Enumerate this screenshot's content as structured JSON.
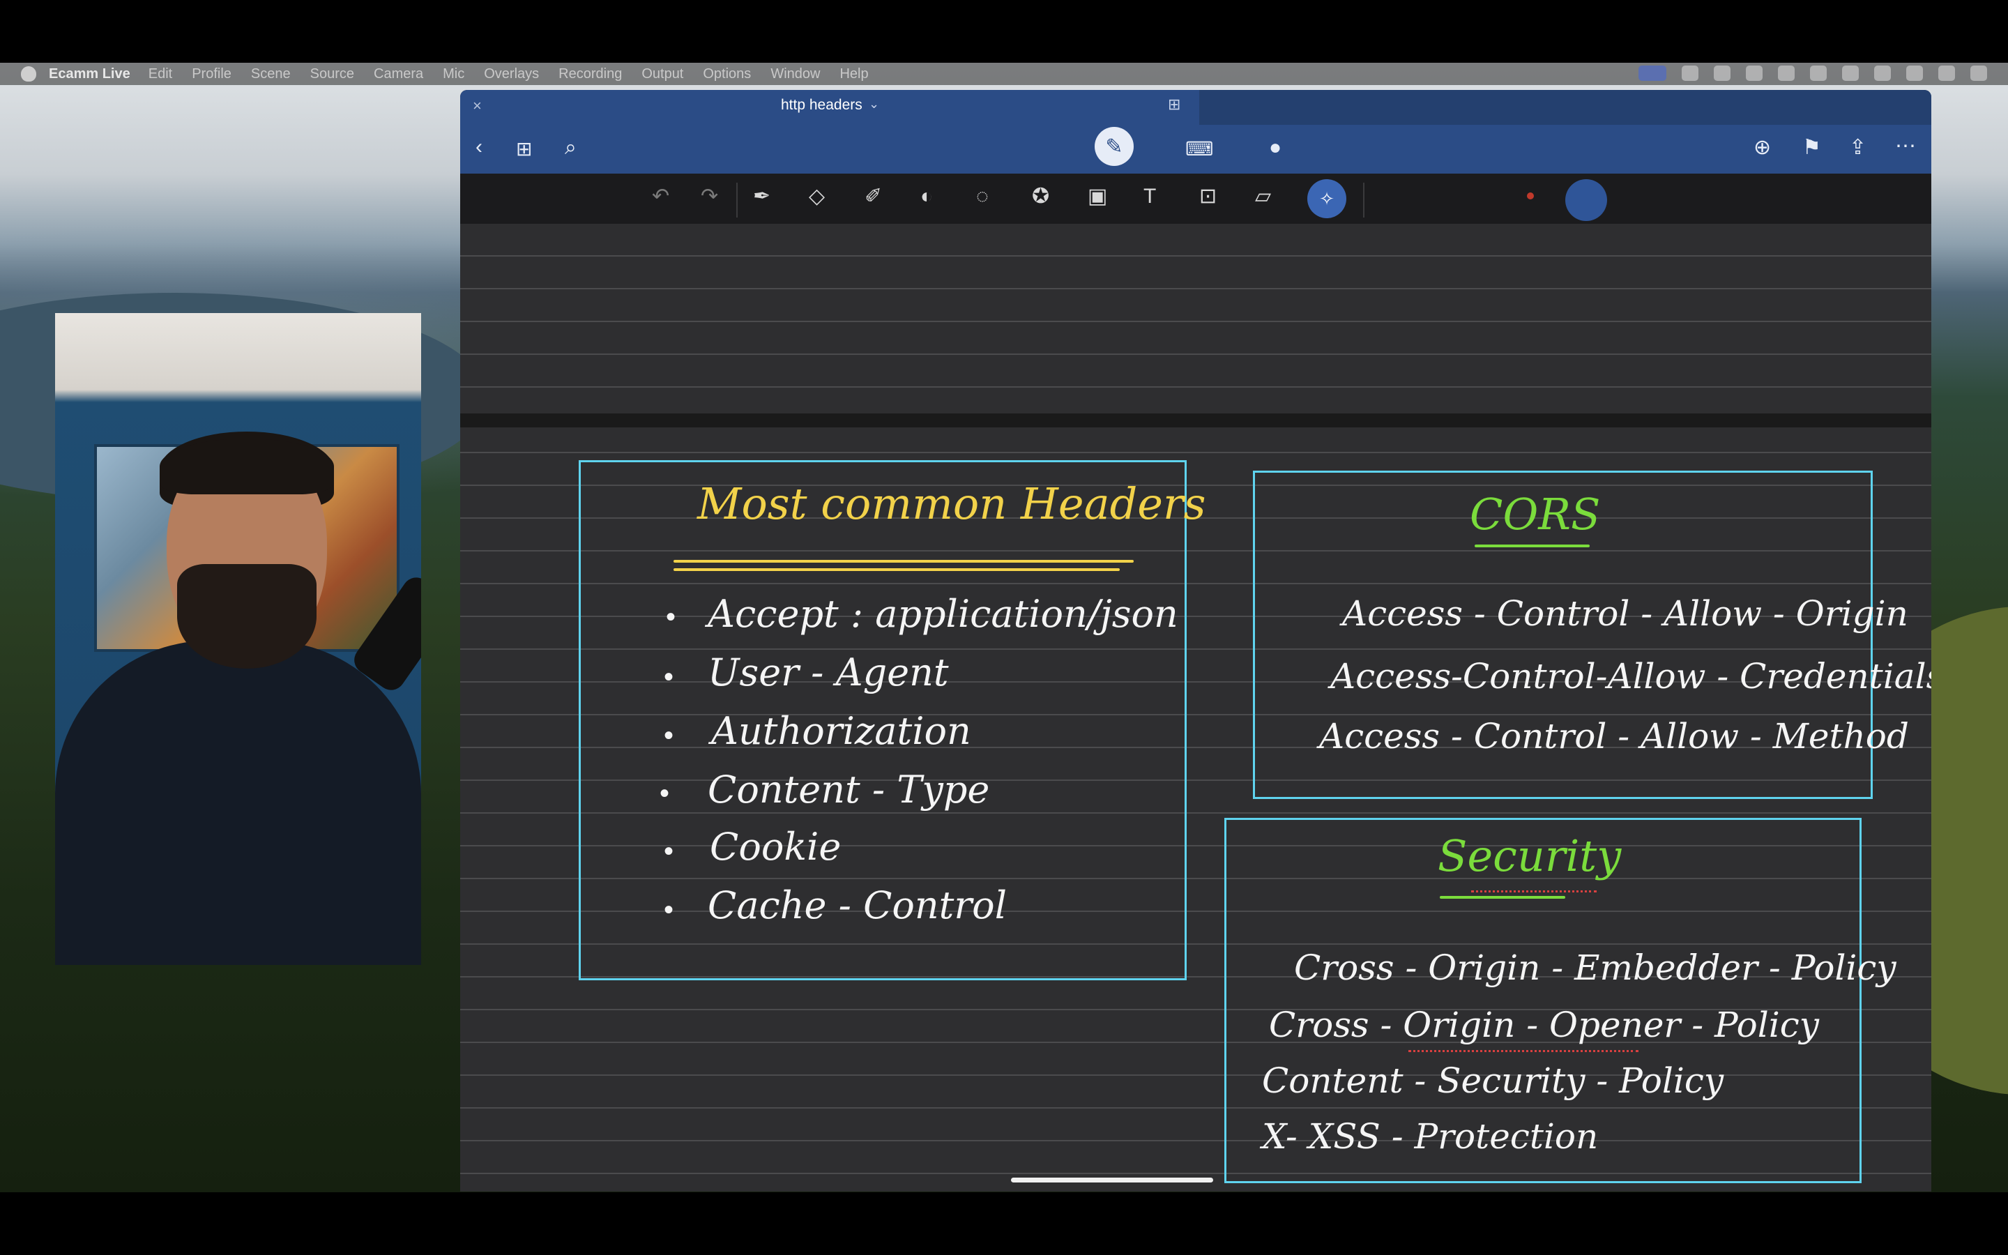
{
  "menubar": {
    "app_name": "Ecamm Live",
    "items": [
      "Edit",
      "Profile",
      "Scene",
      "Source",
      "Camera",
      "Mic",
      "Overlays",
      "Recording",
      "Output",
      "Options",
      "Window",
      "Help"
    ]
  },
  "window": {
    "close_glyph": "×",
    "title": "http headers",
    "title_chevron": "⌄"
  },
  "toolbar": {
    "icons": [
      "back-icon",
      "grid-icon",
      "search-icon",
      "pen-mode-icon",
      "keyboard-icon",
      "mic-icon",
      "add-page-icon",
      "bookmark-icon",
      "share-icon",
      "more-icon"
    ]
  },
  "tools": [
    "undo",
    "redo",
    "pen",
    "eraser",
    "highlighter",
    "shapes",
    "lasso",
    "sticker",
    "image",
    "text",
    "zoom",
    "ruler",
    "laser"
  ],
  "notes": {
    "common": {
      "title": "Most common Headers",
      "items": [
        "Accept : application/json",
        "User - Agent",
        "Authorization",
        "Content - Type",
        "Cookie",
        "Cache - Control"
      ]
    },
    "cors": {
      "title": "CORS",
      "items": [
        "Access - Control - Allow - Origin",
        "Access-Control-Allow - Credentials",
        "Access - Control - Allow - Method"
      ]
    },
    "security": {
      "title": "Security",
      "items": [
        "Cross - Origin - Embedder - Policy",
        "Cross - Origin - Opener - Policy",
        "Content - Security - Policy",
        "X- XSS - Protection"
      ]
    }
  },
  "colors": {
    "accent_blue": "#2b4c86",
    "box_border": "#5fd3ee",
    "title_yellow": "#f2d24a",
    "title_green": "#7bdc3c"
  }
}
